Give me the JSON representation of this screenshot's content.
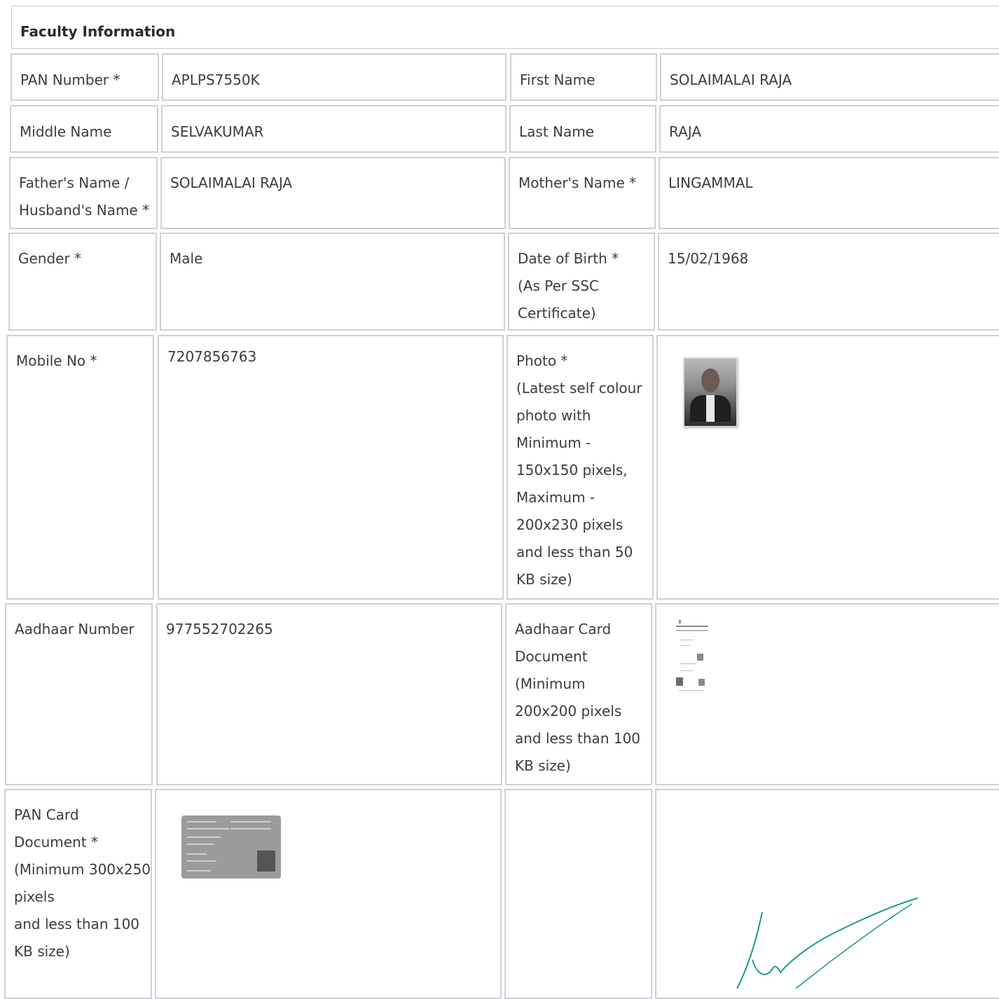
{
  "section": {
    "title": "Faculty Information"
  },
  "fields": {
    "pan_label": "PAN Number *",
    "pan_value": "APLPS7550K",
    "first_name_label": "First Name",
    "first_name_value": "SOLAIMALAI RAJA",
    "middle_name_label": "Middle Name",
    "middle_name_value": "SELVAKUMAR",
    "last_name_label": "Last Name",
    "last_name_value": "RAJA",
    "father_label_1": "Father's Name /",
    "father_label_2": "Husband's Name *",
    "father_value": "SOLAIMALAI RAJA",
    "mother_label": "Mother's Name *",
    "mother_value": "LINGAMMAL",
    "gender_label": "Gender *",
    "gender_value": "Male",
    "dob_label_1": "Date of Birth *",
    "dob_label_2": "(As Per SSC",
    "dob_label_3": "Certificate)",
    "dob_value": "15/02/1968",
    "mobile_label": "Mobile No *",
    "mobile_value": "7207856763",
    "photo_label_lines": [
      "Photo *",
      "(Latest self colour",
      "photo with",
      "Minimum -",
      "150x150 pixels,",
      "Maximum -",
      "200x230 pixels",
      "and less than 50",
      "KB size)"
    ],
    "aadhaar_label": "Aadhaar Number",
    "aadhaar_value": "977552702265",
    "aadhaar_doc_label_lines": [
      "Aadhaar Card",
      "Document",
      "(Minimum",
      "200x200 pixels",
      "and less than 100",
      "KB size)"
    ],
    "pan_doc_label_lines": [
      "PAN Card",
      "Document *",
      "(Minimum 300x250",
      "pixels",
      "and less than 100",
      "KB size)"
    ]
  },
  "colors": {
    "border": "#cfcfd6",
    "text": "#3c3c3c",
    "signature": "#1a9b8a"
  }
}
